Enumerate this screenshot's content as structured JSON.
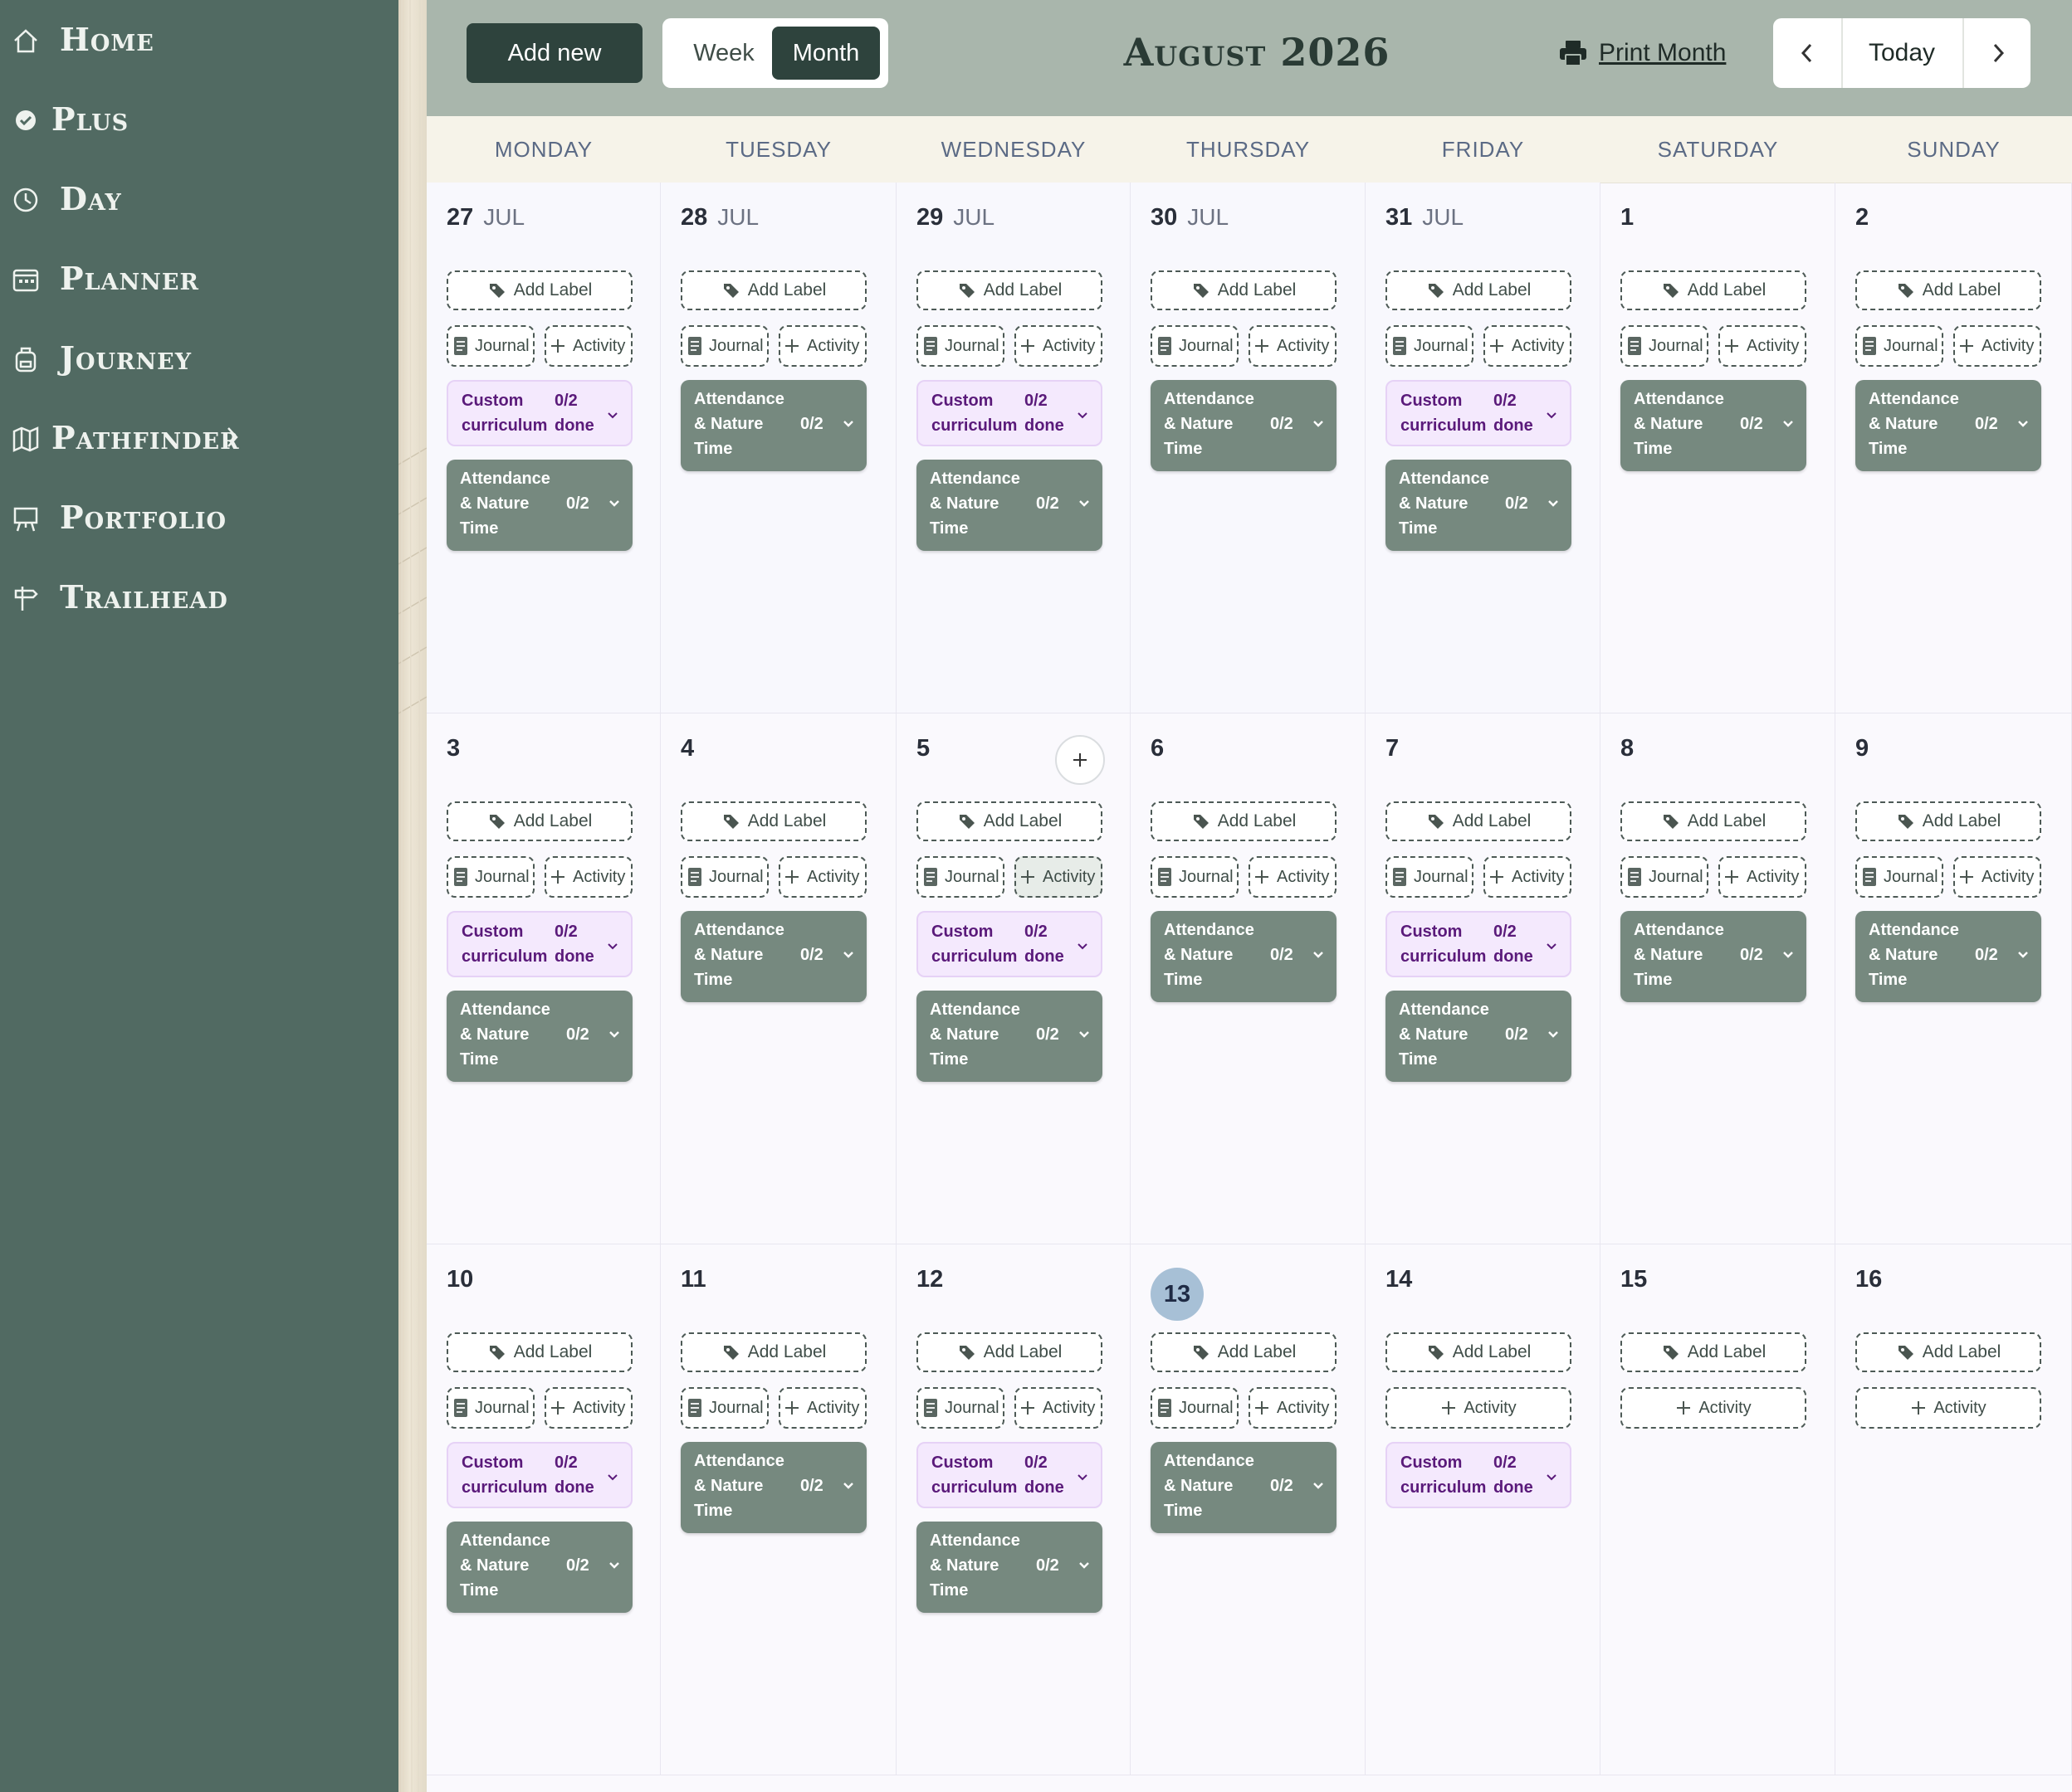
{
  "sidebar": {
    "items": [
      {
        "label": "Home",
        "icon": "home-icon"
      },
      {
        "label": "Plus",
        "icon": "check-circle-icon"
      },
      {
        "label": "Day",
        "icon": "clock-icon"
      },
      {
        "label": "Planner",
        "icon": "calendar-icon"
      },
      {
        "label": "Journey",
        "icon": "backpack-icon"
      },
      {
        "label": "Pathfinder",
        "icon": "map-icon",
        "expand_icon": "chevron-right-icon"
      },
      {
        "label": "Portfolio",
        "icon": "easel-icon"
      },
      {
        "label": "Trailhead",
        "icon": "signpost-icon"
      }
    ]
  },
  "toolbar": {
    "add_new": "Add new",
    "view_week": "Week",
    "view_month": "Month",
    "active_view": "Month",
    "title": "August 2026",
    "print_label": "Print Month",
    "today_label": "Today"
  },
  "weekdays": [
    "MONDAY",
    "TUESDAY",
    "WEDNESDAY",
    "THURSDAY",
    "FRIDAY",
    "SATURDAY",
    "SUNDAY"
  ],
  "labels": {
    "add_label": "Add Label",
    "journal": "Journal",
    "activity": "Activity",
    "custom_name": "Custom curriculum",
    "custom_count": "0/2 done",
    "attendance_name": "Attendance & Nature Time",
    "attendance_count": "0/2"
  },
  "weeks": [
    [
      {
        "day": "27",
        "month": "JUL",
        "journal": true,
        "tasks": [
          "custom",
          "attendance"
        ]
      },
      {
        "day": "28",
        "month": "JUL",
        "journal": true,
        "tasks": [
          "attendance"
        ]
      },
      {
        "day": "29",
        "month": "JUL",
        "journal": true,
        "tasks": [
          "custom",
          "attendance"
        ]
      },
      {
        "day": "30",
        "month": "JUL",
        "journal": true,
        "tasks": [
          "attendance"
        ]
      },
      {
        "day": "31",
        "month": "JUL",
        "journal": true,
        "tasks": [
          "custom",
          "attendance"
        ]
      },
      {
        "day": "1",
        "month": "",
        "journal": true,
        "tasks": [
          "attendance"
        ]
      },
      {
        "day": "2",
        "month": "",
        "journal": true,
        "tasks": [
          "attendance"
        ]
      }
    ],
    [
      {
        "day": "3",
        "month": "",
        "journal": true,
        "tasks": [
          "custom",
          "attendance"
        ]
      },
      {
        "day": "4",
        "month": "",
        "journal": true,
        "tasks": [
          "attendance"
        ]
      },
      {
        "day": "5",
        "month": "",
        "journal": true,
        "tasks": [
          "custom",
          "attendance"
        ],
        "add_button": true,
        "activity_highlight": true
      },
      {
        "day": "6",
        "month": "",
        "journal": true,
        "tasks": [
          "attendance"
        ]
      },
      {
        "day": "7",
        "month": "",
        "journal": true,
        "tasks": [
          "custom",
          "attendance"
        ]
      },
      {
        "day": "8",
        "month": "",
        "journal": true,
        "tasks": [
          "attendance"
        ]
      },
      {
        "day": "9",
        "month": "",
        "journal": true,
        "tasks": [
          "attendance"
        ]
      }
    ],
    [
      {
        "day": "10",
        "month": "",
        "journal": true,
        "tasks": [
          "custom",
          "attendance"
        ]
      },
      {
        "day": "11",
        "month": "",
        "journal": true,
        "tasks": [
          "attendance"
        ]
      },
      {
        "day": "12",
        "month": "",
        "journal": true,
        "tasks": [
          "custom",
          "attendance"
        ]
      },
      {
        "day": "13",
        "month": "",
        "journal": true,
        "tasks": [
          "attendance"
        ],
        "today": true
      },
      {
        "day": "14",
        "month": "",
        "journal": false,
        "tasks": [
          "custom"
        ]
      },
      {
        "day": "15",
        "month": "",
        "journal": false,
        "tasks": []
      },
      {
        "day": "16",
        "month": "",
        "journal": false,
        "tasks": []
      }
    ]
  ],
  "colors": {
    "sidebar": "#516a62",
    "toolbar": "#a9b6ac",
    "primary_button": "#2e433d",
    "attendance_card": "#76897f",
    "custom_card": "#f4e9fd",
    "custom_text": "#5a1a7a",
    "today_circle": "#a7c0d6"
  }
}
